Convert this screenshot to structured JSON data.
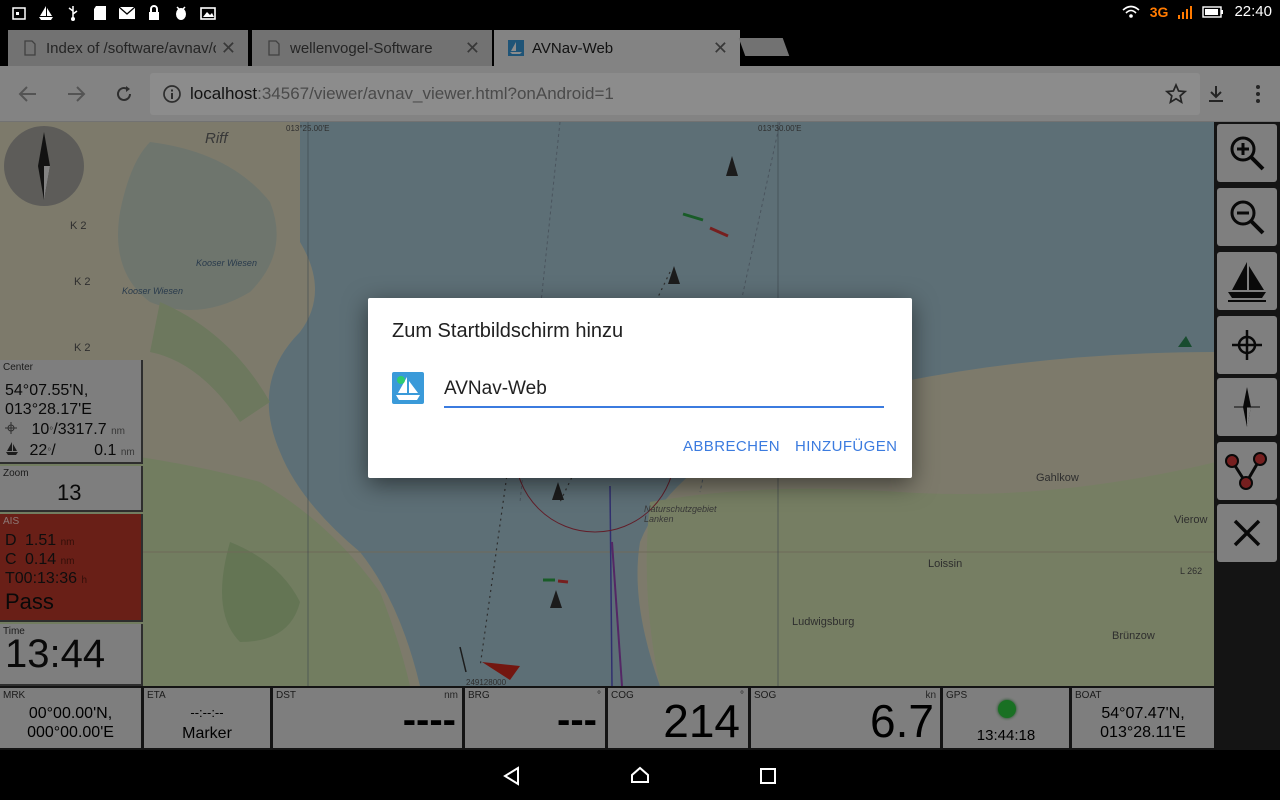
{
  "status_bar": {
    "time": "22:40",
    "network": "3G",
    "left_icons": [
      "calendar-icon",
      "boat-icon",
      "usb-icon",
      "sd-card-icon",
      "mail-icon",
      "lock-icon",
      "android-debug-icon",
      "photo-icon"
    ]
  },
  "tabs": [
    {
      "label": "Index of /software/avnav/c",
      "active": false
    },
    {
      "label": "wellenvogel-Software",
      "active": false
    },
    {
      "label": "AVNav-Web",
      "active": true
    }
  ],
  "toolbar": {
    "url_host": "localhost",
    "url_rest": ":34567/viewer/avnav_viewer.html?onAndroid=1"
  },
  "map": {
    "labels": [
      "Riff",
      "K 2",
      "K 2",
      "K 2",
      "Kooser Wiesen",
      "Kooser Wiesen",
      "Gahlkow",
      "Vierow",
      "Loissin",
      "Ludwigsburg",
      "Brünzow",
      "L 262",
      "Naturschutzgebiet Lanken",
      "013°25.00'E",
      "013°30.00'E",
      "249128000"
    ]
  },
  "left_panel": {
    "center": {
      "label": "Center",
      "lat": "54°07.55'N,",
      "lon": "013°28.17'E",
      "dist_prefix": "10",
      "dist_value": "/3317.7",
      "dist_unit": "nm",
      "boat_prefix": "22",
      "boat_sep": "/",
      "boat_value": "0.1",
      "boat_unit": "nm"
    },
    "zoom": {
      "label": "Zoom",
      "value": "13"
    },
    "ais": {
      "label": "AIS",
      "d_label": "D",
      "d_value": "1.51",
      "d_unit": "nm",
      "c_label": "C",
      "c_value": "0.14",
      "c_unit": "nm",
      "t_label": "T",
      "t_value": "00:13:36",
      "t_unit": "h",
      "status": "Pass",
      "color": "#c0392b"
    },
    "time": {
      "label": "Time",
      "value": "13:44"
    }
  },
  "bottom_bar": {
    "mrk": {
      "label": "MRK",
      "lat": "00°00.00'N,",
      "lon": "000°00.00'E"
    },
    "eta": {
      "label": "ETA",
      "value": "--:--:--",
      "name": "Marker"
    },
    "dst": {
      "label": "DST",
      "unit": "nm",
      "value": "----"
    },
    "brg": {
      "label": "BRG",
      "unit": "°",
      "value": "---"
    },
    "cog": {
      "label": "COG",
      "unit": "°",
      "value": "214"
    },
    "sog": {
      "label": "SOG",
      "unit": "kn",
      "value": "6.7"
    },
    "gps": {
      "label": "GPS",
      "time": "13:44:18",
      "status_color": "#2ecc40"
    },
    "boat": {
      "label": "BOAT",
      "lat": "54°07.47'N,",
      "lon": "013°28.11'E"
    }
  },
  "right_tools": [
    "zoom-in-icon",
    "zoom-out-icon",
    "sailboat-icon",
    "crosshair-icon",
    "compass-icon",
    "route-icon",
    "close-icon"
  ],
  "dialog": {
    "title": "Zum Startbildschirm hinzu",
    "input_value": "AVNav-Web",
    "cancel": "ABBRECHEN",
    "add": "HINZUFÜGEN"
  }
}
